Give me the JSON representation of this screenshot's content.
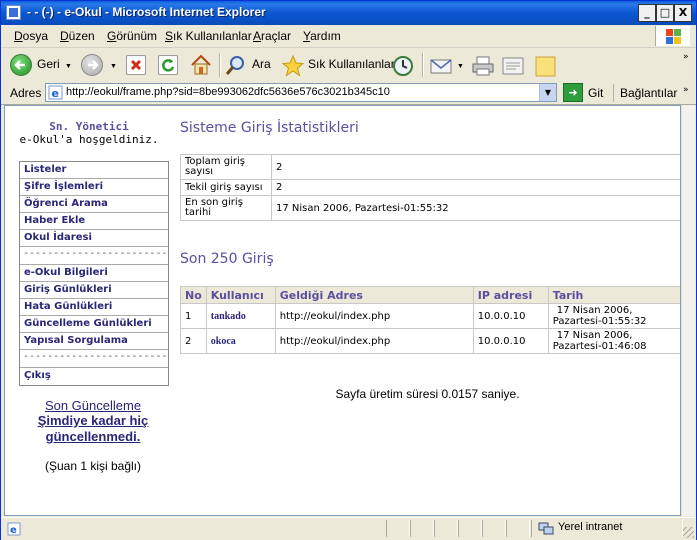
{
  "window": {
    "title": " - - (-) - e-Okul  - Microsoft Internet Explorer",
    "minimize_glyph": "_",
    "maximize_glyph": "□",
    "close_glyph": "X"
  },
  "menu": [
    "Dosya",
    "Düzen",
    "Görünüm",
    "Sık Kullanılanlar",
    "Araçlar",
    "Yardım"
  ],
  "toolbar": {
    "back_label": "Geri",
    "search_label": "Ara",
    "favorites_label": "Sık Kullanılanlar"
  },
  "address": {
    "label": "Adres",
    "url": "http://eokul/frame.php?sid=8be993062dfc5636e576c3021b345c10",
    "go_label": "Git",
    "links_label": "Bağlantılar"
  },
  "sidebar": {
    "admin_title": "Sn. Yönetici",
    "welcome": "e-Okul'a hoşgeldiniz.",
    "items": [
      {
        "label": "Listeler",
        "type": "link"
      },
      {
        "label": "Şifre İşlemleri",
        "type": "link"
      },
      {
        "label": "Öğrenci Arama",
        "type": "link"
      },
      {
        "label": "Haber Ekle",
        "type": "link"
      },
      {
        "label": "Okul İdaresi",
        "type": "link"
      },
      {
        "label": "-------------------------",
        "type": "sep"
      },
      {
        "label": "e-Okul Bilgileri",
        "type": "link"
      },
      {
        "label": "Giriş Günlükleri",
        "type": "link"
      },
      {
        "label": "Hata Günlükleri",
        "type": "link"
      },
      {
        "label": "Güncelleme Günlükleri",
        "type": "link"
      },
      {
        "label": "Yapısal Sorgulama",
        "type": "link"
      },
      {
        "label": "-------------------------",
        "type": "sep"
      },
      {
        "label": "Çıkış",
        "type": "link"
      }
    ],
    "update_title": "Son Güncelleme",
    "update_line1": "Şimdiye kadar hiç",
    "update_line2": "güncellenmedi.",
    "online": "(Şuan 1 kişi bağlı)"
  },
  "stats": {
    "heading": "Sisteme Giriş İstatistikleri",
    "rows": [
      {
        "key": "Toplam giriş sayısı",
        "value": "2"
      },
      {
        "key": "Tekil giriş sayısı",
        "value": "2"
      },
      {
        "key": "En son giriş tarihi",
        "value": "17 Nisan 2006, Pazartesi-01:55:32"
      }
    ]
  },
  "recent": {
    "heading": "Son 250 Giriş",
    "columns": [
      "No",
      "Kullanıcı",
      "Geldiği Adres",
      "IP adresi",
      "Tarih"
    ],
    "rows": [
      {
        "no": "1",
        "user": "tankado",
        "from": "http://eokul/index.php",
        "ip": "10.0.0.10",
        "date1": "17 Nisan 2006,",
        "date2": "Pazartesi-01:55:32"
      },
      {
        "no": "2",
        "user": "okoca",
        "from": "http://eokul/index.php",
        "ip": "10.0.0.10",
        "date1": "17 Nisan 2006,",
        "date2": "Pazartesi-01:46:08"
      }
    ]
  },
  "timing": "Sayfa üretim süresi 0.0157 saniye.",
  "status": {
    "zone": "Yerel intranet"
  },
  "colors": {
    "heading": "#5a4fa0",
    "link": "#2a2677",
    "titlebar": "#0b58d0"
  }
}
